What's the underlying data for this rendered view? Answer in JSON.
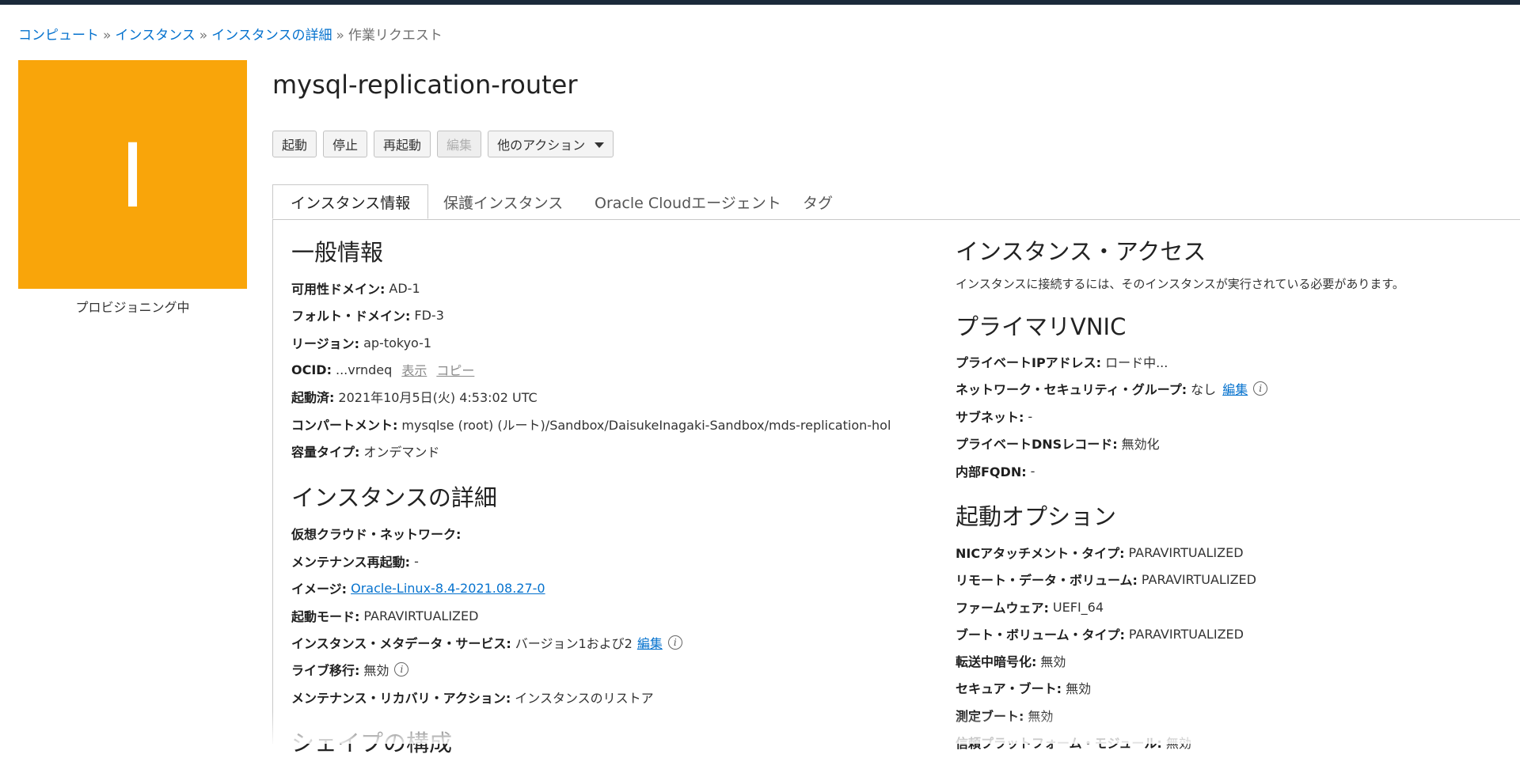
{
  "breadcrumb": {
    "items": [
      "コンピュート",
      "インスタンス",
      "インスタンスの詳細"
    ],
    "separator": "»",
    "current": "作業リクエスト"
  },
  "avatar": {
    "letter": "I",
    "color": "#f9a50a",
    "state": "プロビジョニング中"
  },
  "page": {
    "title": "mysql-replication-router"
  },
  "actions": {
    "start": "起動",
    "stop": "停止",
    "reboot": "再起動",
    "edit": "編集",
    "more": "他のアクション"
  },
  "tabs": [
    "インスタンス情報",
    "保護インスタンス",
    "Oracle Cloudエージェント",
    "タグ"
  ],
  "general": {
    "title": "一般情報",
    "availability_domain": {
      "label": "可用性ドメイン:",
      "value": "AD-1"
    },
    "fault_domain": {
      "label": "フォルト・ドメイン:",
      "value": "FD-3"
    },
    "region": {
      "label": "リージョン:",
      "value": "ap-tokyo-1"
    },
    "ocid": {
      "label": "OCID:",
      "value": "...vrndeq",
      "show": "表示",
      "copy": "コピー"
    },
    "launched": {
      "label": "起動済:",
      "value": "2021年10月5日(火) 4:53:02 UTC"
    },
    "compartment": {
      "label": "コンパートメント:",
      "value": "mysqlse (root) (ルート)/Sandbox/DaisukeInagaki-Sandbox/mds-replication-hol"
    },
    "capacity_type": {
      "label": "容量タイプ:",
      "value": "オンデマンド"
    }
  },
  "instance_details": {
    "title": "インスタンスの詳細",
    "vcn": {
      "label": "仮想クラウド・ネットワーク:",
      "value": ""
    },
    "maintenance_reboot": {
      "label": "メンテナンス再起動:",
      "value": "-"
    },
    "image": {
      "label": "イメージ:",
      "value": "Oracle-Linux-8.4-2021.08.27-0"
    },
    "launch_mode": {
      "label": "起動モード:",
      "value": "PARAVIRTUALIZED"
    },
    "metadata_service": {
      "label": "インスタンス・メタデータ・サービス:",
      "value": "バージョン1および2",
      "edit": "編集"
    },
    "live_migration": {
      "label": "ライブ移行:",
      "value": "無効"
    },
    "maintenance_recovery": {
      "label": "メンテナンス・リカバリ・アクション:",
      "value": "インスタンスのリストア"
    }
  },
  "shape_config": {
    "title": "シェイプの構成"
  },
  "instance_access": {
    "title": "インスタンス・アクセス",
    "note": "インスタンスに接続するには、そのインスタンスが実行されている必要があります。"
  },
  "primary_vnic": {
    "title": "プライマリVNIC",
    "private_ip": {
      "label": "プライベートIPアドレス:",
      "value": "ロード中..."
    },
    "nsg": {
      "label": "ネットワーク・セキュリティ・グループ:",
      "value": "なし",
      "edit": "編集"
    },
    "subnet": {
      "label": "サブネット:",
      "value": "-"
    },
    "private_dns": {
      "label": "プライベートDNSレコード:",
      "value": "無効化"
    },
    "internal_fqdn": {
      "label": "内部FQDN:",
      "value": "-"
    }
  },
  "launch_options": {
    "title": "起動オプション",
    "nic_attachment": {
      "label": "NICアタッチメント・タイプ:",
      "value": "PARAVIRTUALIZED"
    },
    "remote_data_volume": {
      "label": "リモート・データ・ボリューム:",
      "value": "PARAVIRTUALIZED"
    },
    "firmware": {
      "label": "ファームウェア:",
      "value": "UEFI_64"
    },
    "boot_volume_type": {
      "label": "ブート・ボリューム・タイプ:",
      "value": "PARAVIRTUALIZED"
    },
    "in_transit_encryption": {
      "label": "転送中暗号化:",
      "value": "無効"
    },
    "secure_boot": {
      "label": "セキュア・ブート:",
      "value": "無効"
    },
    "measured_boot": {
      "label": "測定ブート:",
      "value": "無効"
    },
    "tpm": {
      "label": "信頼プラットフォーム・モジュール:",
      "value": "無効"
    }
  }
}
